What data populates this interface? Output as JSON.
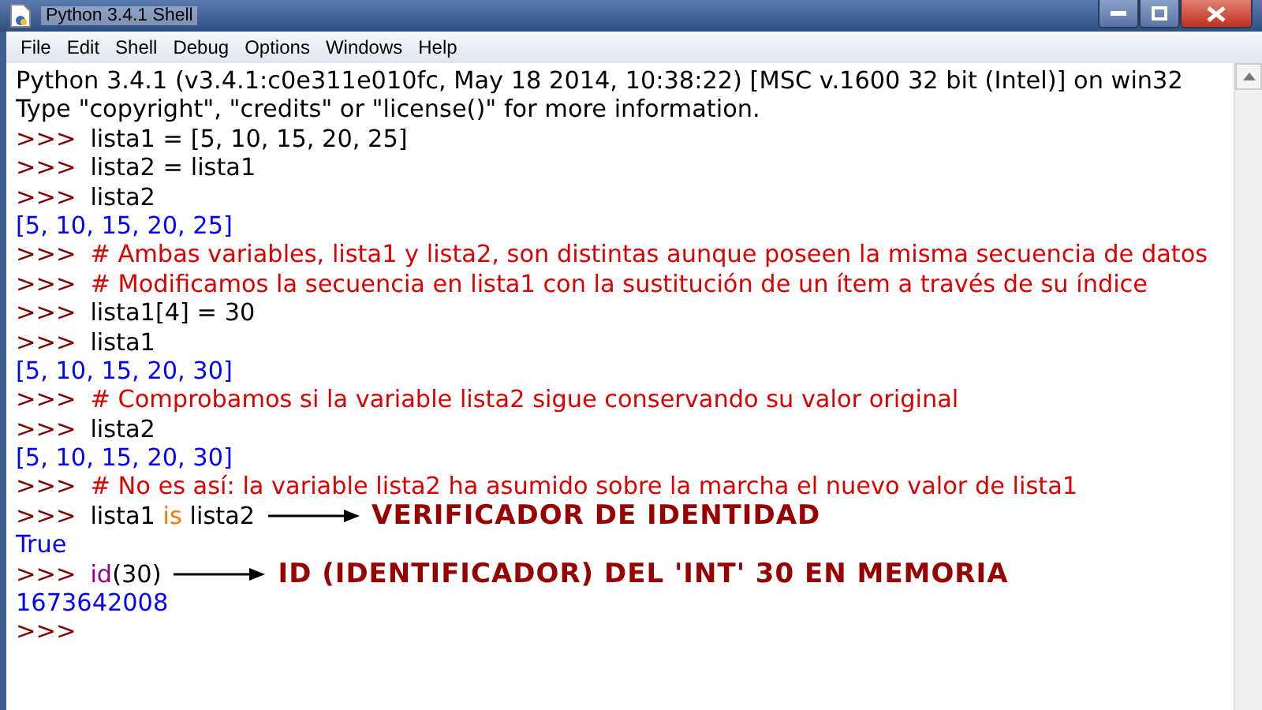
{
  "window": {
    "title": "Python 3.4.1 Shell"
  },
  "menu": [
    "File",
    "Edit",
    "Shell",
    "Debug",
    "Options",
    "Windows",
    "Help"
  ],
  "lines": [
    [
      {
        "kind": "output_plain",
        "text": "Python 3.4.1 (v3.4.1:c0e311e010fc, May 18 2014, 10:38:22) [MSC v.1600 32 bit (Intel)] on win32"
      }
    ],
    [
      {
        "kind": "output_plain",
        "text": "Type \"copyright\", \"credits\" or \"license()\" for more information."
      }
    ],
    [
      {
        "kind": "prompt",
        "text": ">>>"
      },
      {
        "kind": "code",
        "text": "lista1 = [5, 10, 15, 20, 25]"
      }
    ],
    [
      {
        "kind": "prompt",
        "text": ">>>"
      },
      {
        "kind": "code",
        "text": "lista2 = lista1"
      }
    ],
    [
      {
        "kind": "prompt",
        "text": ">>>"
      },
      {
        "kind": "code",
        "text": "lista2"
      }
    ],
    [
      {
        "kind": "output",
        "text": "[5, 10, 15, 20, 25]"
      }
    ],
    [
      {
        "kind": "prompt",
        "text": ">>>"
      },
      {
        "kind": "comment",
        "text": "# Ambas variables, lista1 y lista2, son distintas aunque poseen la misma secuencia de datos"
      }
    ],
    [
      {
        "kind": "prompt",
        "text": ">>>"
      },
      {
        "kind": "comment",
        "text": "# Modificamos la secuencia en lista1 con la sustitución de un ítem a través de su índice"
      }
    ],
    [
      {
        "kind": "prompt",
        "text": ">>>"
      },
      {
        "kind": "code",
        "text": "lista1[4] = 30"
      }
    ],
    [
      {
        "kind": "prompt",
        "text": ">>>"
      },
      {
        "kind": "code",
        "text": "lista1"
      }
    ],
    [
      {
        "kind": "output",
        "text": "[5, 10, 15, 20, 30]"
      }
    ],
    [
      {
        "kind": "prompt",
        "text": ">>>"
      },
      {
        "kind": "comment",
        "text": "# Comprobamos si la variable lista2 sigue conservando su valor original"
      }
    ],
    [
      {
        "kind": "prompt",
        "text": ">>>"
      },
      {
        "kind": "code",
        "text": "lista2"
      }
    ],
    [
      {
        "kind": "output",
        "text": "[5, 10, 15, 20, 30]"
      }
    ],
    [
      {
        "kind": "prompt",
        "text": ">>>"
      },
      {
        "kind": "comment",
        "text": "# No es así: la variable lista2 ha asumido sobre la marcha el nuevo valor de lista1"
      }
    ],
    [
      {
        "kind": "prompt",
        "text": ">>>"
      },
      {
        "kind": "code",
        "text": "lista1 "
      },
      {
        "kind": "keyword",
        "text": "is"
      },
      {
        "kind": "code",
        "text": " lista2"
      },
      {
        "kind": "annotation",
        "text": "VERIFICADOR DE IDENTIDAD"
      }
    ],
    [
      {
        "kind": "output",
        "text": "True"
      }
    ],
    [
      {
        "kind": "prompt",
        "text": ">>>"
      },
      {
        "kind": "builtin",
        "text": "id"
      },
      {
        "kind": "code",
        "text": "(30)"
      },
      {
        "kind": "annotation",
        "text": "ID (IDENTIFICADOR) DEL 'INT' 30 EN MEMORIA"
      }
    ],
    [
      {
        "kind": "output",
        "text": "1673642008"
      }
    ],
    [
      {
        "kind": "prompt",
        "text": ">>>"
      }
    ]
  ]
}
